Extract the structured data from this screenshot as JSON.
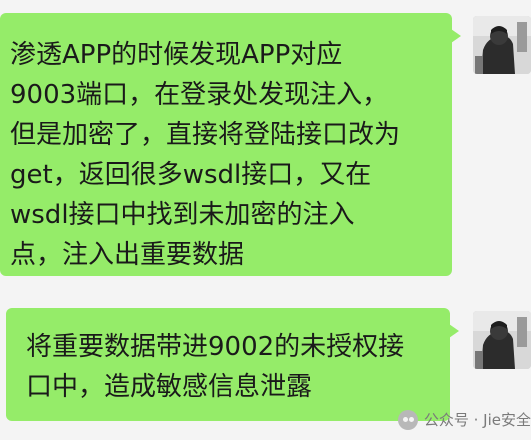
{
  "messages": [
    {
      "text": "渗透APP的时候发现APP对应9003端口，在登录处发现注入，但是加密了，直接将登陆接口改为get，返回很多wsdl接口，又在wsdl接口中找到未加密的注入点，注入出重要数据",
      "lines": [
        "渗透APP的时候发现APP对应",
        "9003端口，在登录处发现注入，",
        "但是加密了，直接将登陆接口改为",
        "get，返回很多wsdl接口，又在",
        "wsdl接口中找到未加密的注入",
        "点，注入出重要数据"
      ]
    },
    {
      "text": "将重要数据带进9002的未授权接口中，造成敏感信息泄露",
      "lines": [
        "将重要数据带进9002的未授权接",
        "口中，造成敏感信息泄露"
      ]
    }
  ],
  "watermark": {
    "text": "公众号 · Jie安全",
    "icon": "wechat-icon"
  },
  "colors": {
    "bubble": "#95ec69",
    "background": "#f4f4f4"
  }
}
